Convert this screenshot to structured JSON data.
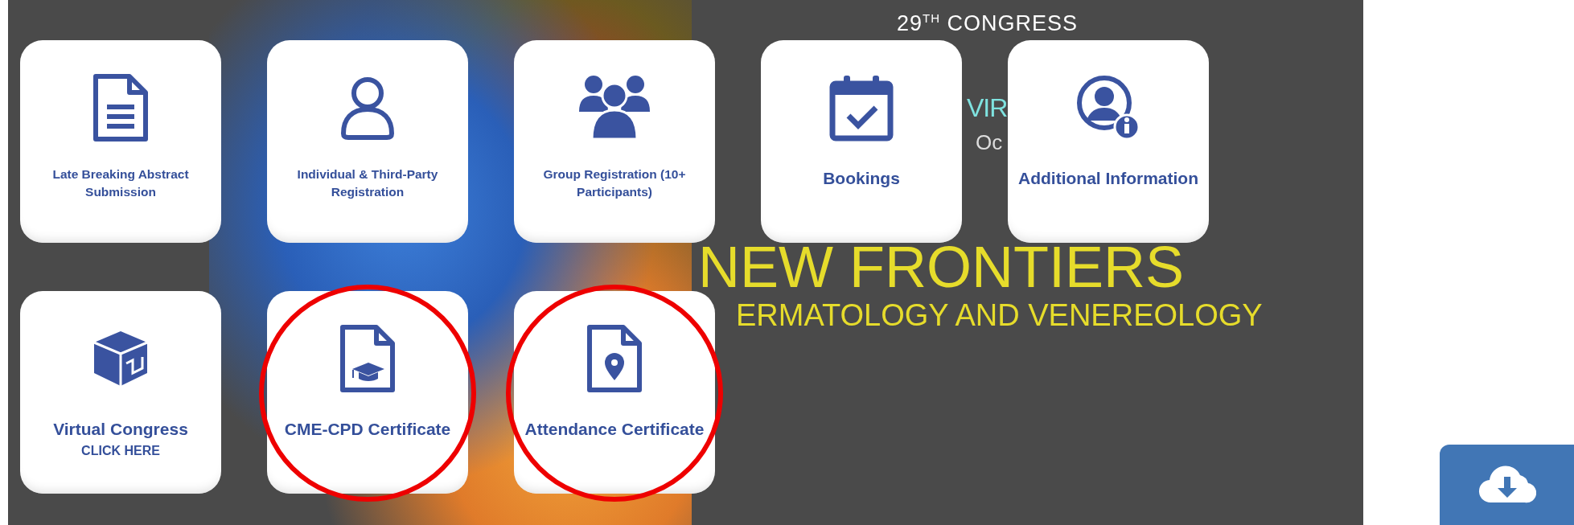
{
  "banner": {
    "edition": "29",
    "edition_suffix": "TH",
    "congress": "CONGRESS",
    "logo_fragment": "VIR",
    "date_fragment": "Oc",
    "headline": "NEW FRONTIERS",
    "subheadline": "ERMATOLOGY AND VENEREOLOGY"
  },
  "tiles": [
    {
      "label": "Late Breaking Abstract Submission",
      "kind": "small",
      "highlighted": false
    },
    {
      "label": "Individual & Third-Party Registration",
      "kind": "small",
      "highlighted": false
    },
    {
      "label": "Group Registration (10+ Participants)",
      "kind": "small",
      "highlighted": false
    },
    {
      "label": "Bookings",
      "kind": "large",
      "highlighted": false
    },
    {
      "label": "Additional Information",
      "kind": "large",
      "highlighted": false
    },
    {
      "label": "Virtual Congress",
      "sublabel": "CLICK HERE",
      "kind": "large",
      "highlighted": false
    },
    {
      "label": "CME-CPD Certificate",
      "kind": "large",
      "highlighted": true
    },
    {
      "label": "Attendance Certificate",
      "kind": "large",
      "highlighted": true
    }
  ]
}
